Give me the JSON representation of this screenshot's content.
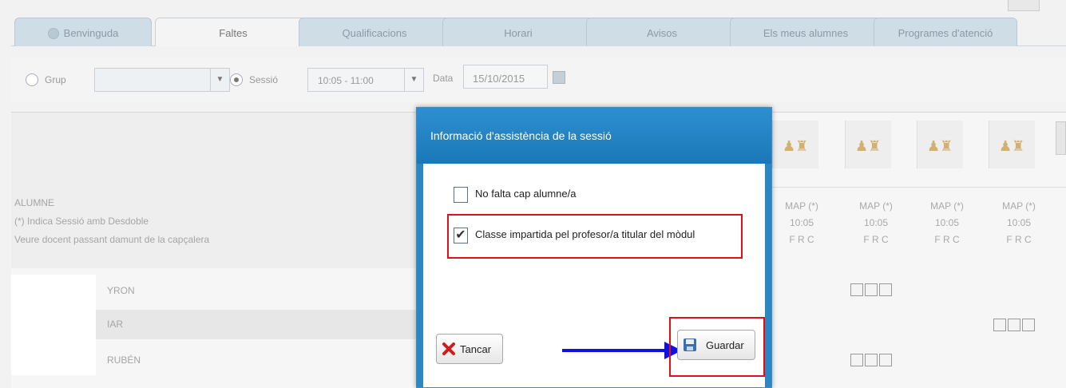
{
  "tabs": [
    {
      "label": "Benvinguda",
      "active": false
    },
    {
      "label": "Faltes",
      "active": true
    },
    {
      "label": "Qualificacions",
      "active": false
    },
    {
      "label": "Horari",
      "active": false
    },
    {
      "label": "Avisos",
      "active": false
    },
    {
      "label": "Els meus alumnes",
      "active": false
    },
    {
      "label": "Programes d'atenció",
      "active": false
    }
  ],
  "filters": {
    "grup_label": "Grup",
    "sessio_label": "Sessió",
    "sessio_value": "10:05 - 11:00",
    "data_label": "Data",
    "data_value": "15/10/2015",
    "selected_mode": "Sessió"
  },
  "grid": {
    "student_header": [
      "ALUMNE",
      "(*) Indica Sessió amb Desdoble",
      "Veure docent passant damunt de la capçalera"
    ],
    "students": [
      "YRON",
      "IAR",
      "RUBÉN"
    ],
    "columns": [
      {
        "subject": "MAP (*)",
        "time": "10:05",
        "codes": "F R C"
      },
      {
        "subject": "MAP (*)",
        "time": "10:05",
        "codes": "F R C"
      },
      {
        "subject": "MAP (*)",
        "time": "10:05",
        "codes": "F R C"
      },
      {
        "subject": "MAP (*)",
        "time": "10:05",
        "codes": "F R C"
      }
    ]
  },
  "dialog": {
    "title": "Informació d'assistència de la sessió",
    "options": [
      {
        "label": "No falta cap alumne/a",
        "checked": false
      },
      {
        "label": "Classe impartida pel profesor/a titular del mòdul",
        "checked": true
      }
    ],
    "close_label": "Tancar",
    "save_label": "Guardar"
  },
  "colors": {
    "dialog_title_bg": "#1f80c2",
    "highlight": "#e0101b",
    "arrow": "#1010e0"
  }
}
